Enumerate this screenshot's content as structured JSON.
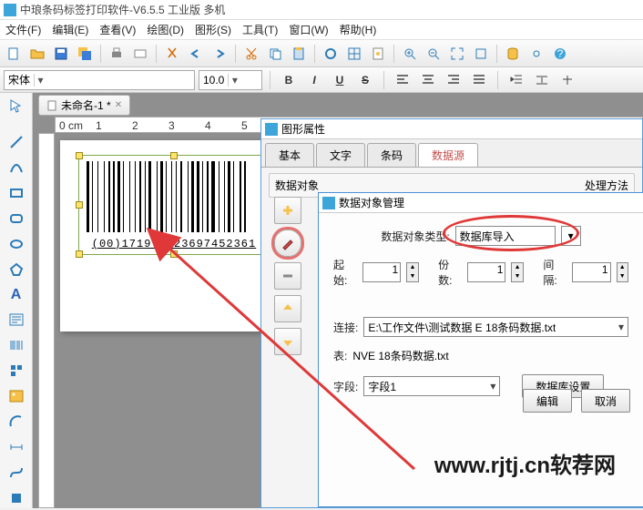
{
  "app": {
    "title": "中琅条码标签打印软件-V6.5.5 工业版 多机"
  },
  "menus": [
    "文件(F)",
    "编辑(E)",
    "查看(V)",
    "绘图(D)",
    "图形(S)",
    "工具(T)",
    "窗口(W)",
    "帮助(H)"
  ],
  "font": {
    "family": "宋体",
    "size": "10.0"
  },
  "doc": {
    "tab_name": "未命名-1 *"
  },
  "barcode": {
    "text": "(00)171978523697452361"
  },
  "prop_panel": {
    "title": "图形属性",
    "tabs": [
      "基本",
      "文字",
      "条码",
      "数据源"
    ],
    "active_tab": 3,
    "section_left": "数据对象",
    "section_right": "处理方法"
  },
  "dialog": {
    "title": "数据对象管理",
    "type_label": "数据对象类型:",
    "type_value": "数据库导入",
    "start_label": "起始:",
    "start_value": "1",
    "count_label": "份数:",
    "count_value": "1",
    "gap_label": "间隔:",
    "gap_value": "1",
    "conn_label": "连接:",
    "conn_value": "E:\\工作文件\\测试数据      E 18条码数据.txt",
    "table_label": "表:",
    "table_value": "NVE 18条码数据.txt",
    "field_label": "字段:",
    "field_value": "字段1",
    "db_btn": "数据库设置",
    "edit_btn": "编辑",
    "cancel_btn": "取消"
  },
  "watermark": "www.rjtj.cn软荐网"
}
